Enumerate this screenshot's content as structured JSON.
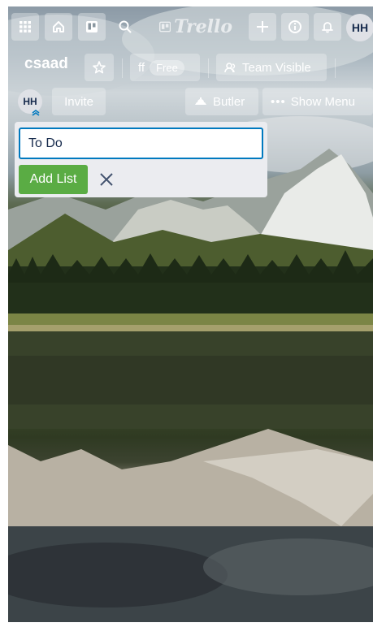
{
  "topbar": {
    "logo_text": "Trello",
    "avatar_initials": "HH",
    "icons": [
      "apps-grid-icon",
      "home-icon",
      "boards-icon",
      "search-icon",
      "plus-icon",
      "info-icon",
      "bell-icon"
    ]
  },
  "board": {
    "title": "csaad",
    "team_label": "ff",
    "plan_badge": "Free",
    "visibility_label": "Team Visible",
    "invite_label": "Invite",
    "butler_label": "Butler",
    "menu_label": "Show Menu",
    "member_initials": "HH"
  },
  "add_list": {
    "input_value": "To Do",
    "submit_label": "Add List"
  },
  "colors": {
    "accent_blue": "#0079bf",
    "add_green": "#5aac44",
    "panel_bg": "#ebecf0"
  }
}
